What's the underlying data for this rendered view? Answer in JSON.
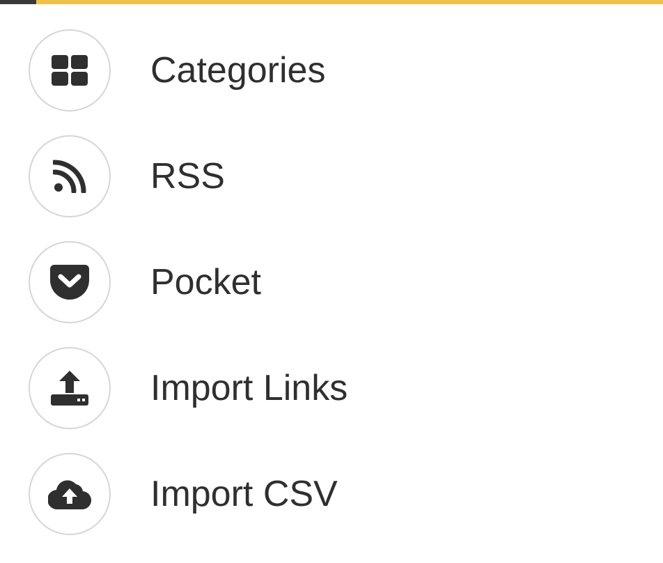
{
  "colors": {
    "accent_bar": "#f0c04a",
    "icon": "#2f2f2f",
    "circle_border": "#d6d6d6",
    "label": "#2f2f2f"
  },
  "menu": {
    "items": [
      {
        "label": "Categories",
        "icon": "grid-icon"
      },
      {
        "label": "RSS",
        "icon": "rss-icon"
      },
      {
        "label": "Pocket",
        "icon": "pocket-icon"
      },
      {
        "label": "Import Links",
        "icon": "upload-icon"
      },
      {
        "label": "Import CSV",
        "icon": "cloud-upload-icon"
      }
    ]
  }
}
